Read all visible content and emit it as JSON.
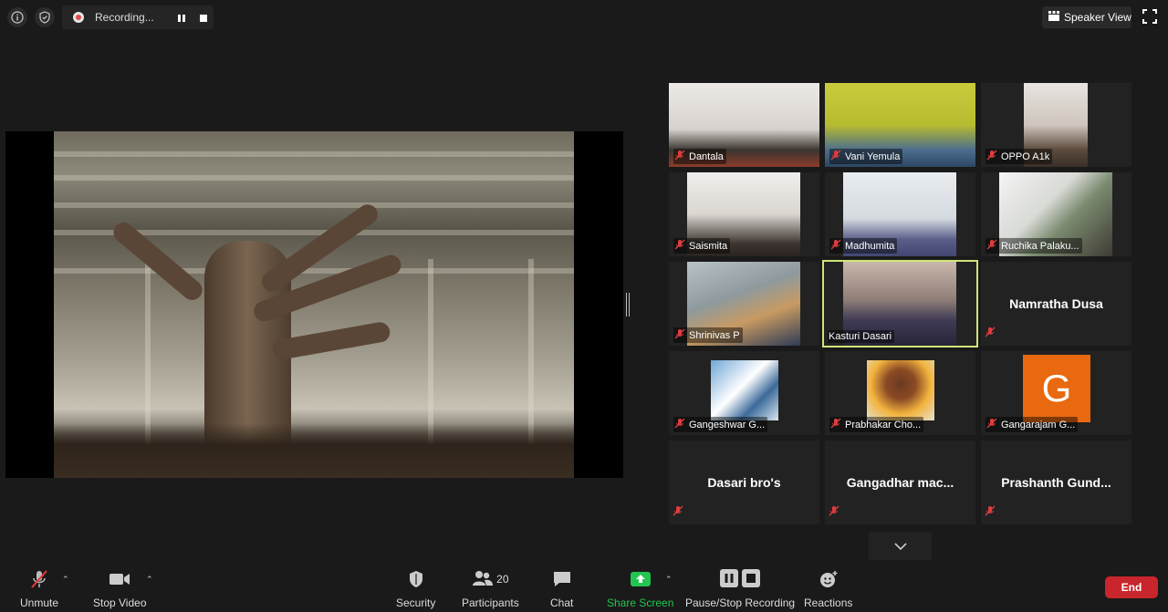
{
  "topbar": {
    "recording_label": "Recording...",
    "speaker_view_label": "Speaker View"
  },
  "participants": [
    {
      "name": "Dantala",
      "video": true,
      "muted": true
    },
    {
      "name": "Vani Yemula",
      "video": true,
      "muted": true
    },
    {
      "name": "OPPO A1k",
      "video": true,
      "muted": true
    },
    {
      "name": "Saismita",
      "video": true,
      "muted": true
    },
    {
      "name": "Madhumita",
      "video": true,
      "muted": true
    },
    {
      "name": "Ruchika Palaku...",
      "video": true,
      "muted": true
    },
    {
      "name": "Shrinivas P",
      "video": true,
      "muted": true
    },
    {
      "name": "Kasturi Dasari",
      "video": true,
      "muted": false,
      "active_speaker": true
    },
    {
      "name": "Namratha Dusa",
      "video": false,
      "muted": true
    },
    {
      "name": "Gangeshwar G...",
      "video": true,
      "muted": true
    },
    {
      "name": "Prabhakar Cho...",
      "video": true,
      "muted": true
    },
    {
      "name": "Gangarajam G...",
      "video": false,
      "avatar_letter": "G",
      "muted": true
    },
    {
      "name": "Dasari bro's",
      "video": false,
      "muted": true
    },
    {
      "name": "Gangadhar  mac...",
      "video": false,
      "muted": true
    },
    {
      "name": "Prashanth  Gund...",
      "video": false,
      "muted": true
    }
  ],
  "toolbar": {
    "unmute": "Unmute",
    "stop_video": "Stop Video",
    "security": "Security",
    "participants": "Participants",
    "participants_count": "20",
    "chat": "Chat",
    "share_screen": "Share Screen",
    "pause_stop_recording": "Pause/Stop Recording",
    "reactions": "Reactions",
    "end": "End"
  },
  "colors": {
    "background": "#1a1a1a",
    "tile": "#222222",
    "active_speaker_border": "#cfe57a",
    "share_green": "#23c551",
    "end_red": "#c8252c",
    "muted_red": "#e03c3c",
    "avatar_orange": "#e8690f"
  }
}
